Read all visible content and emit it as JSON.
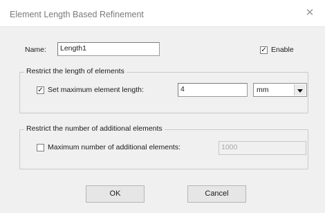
{
  "window": {
    "title": "Element Length Based Refinement",
    "close_glyph": "✕"
  },
  "name": {
    "label": "Name:",
    "value": "Length1"
  },
  "enable": {
    "label": "Enable",
    "checked": true
  },
  "group_length": {
    "legend": "Restrict the length of elements",
    "max_length_label": "Set maximum element length:",
    "max_length_checked": true,
    "max_length_value": "4",
    "unit_selected": "mm"
  },
  "group_count": {
    "legend": "Restrict the number of additional elements",
    "max_additional_label": "Maximum number of additional elements:",
    "max_additional_checked": false,
    "max_additional_value": "1000"
  },
  "buttons": {
    "ok": "OK",
    "cancel": "Cancel"
  },
  "icons": {
    "check": "checkmark-icon",
    "dropdown": "chevron-down-icon",
    "close": "close-icon"
  }
}
